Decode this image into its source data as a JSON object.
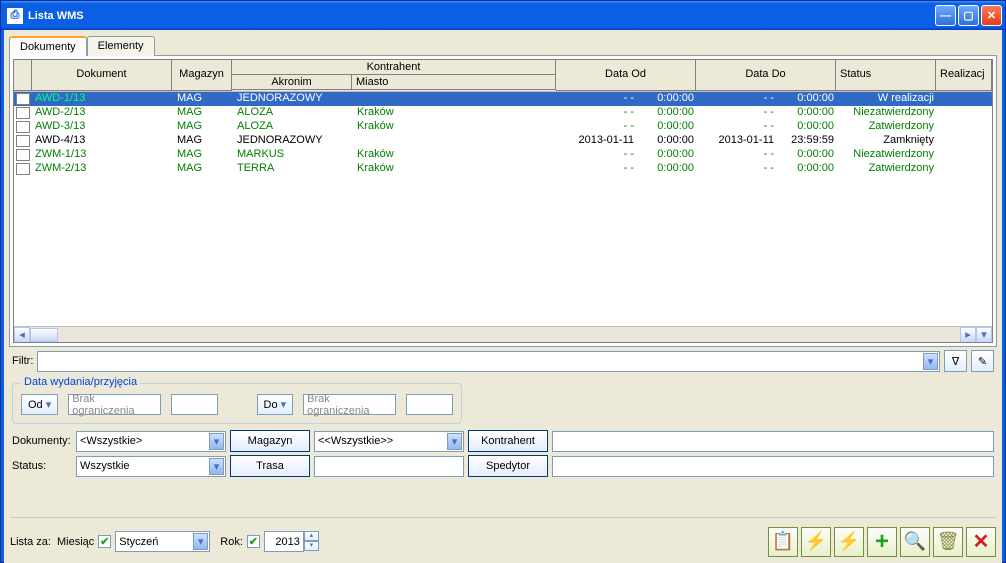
{
  "window": {
    "title": "Lista WMS"
  },
  "tabs": [
    {
      "label": "Dokumenty",
      "active": true
    },
    {
      "label": "Elementy",
      "active": false
    }
  ],
  "grid": {
    "headers": {
      "dokument": "Dokument",
      "magazyn": "Magazyn",
      "kontrahent": "Kontrahent",
      "akronim": "Akronim",
      "miasto": "Miasto",
      "dataod": "Data Od",
      "datado": "Data Do",
      "status": "Status",
      "realizacj": "Realizacj"
    },
    "rows": [
      {
        "sel": true,
        "green": true,
        "dokument": "AWD-1/13",
        "magazyn": "MAG",
        "akronim": "JEDNORAZOWY",
        "miasto": "",
        "od_d": "- -",
        "od_t": "0:00:00",
        "do_d": "- -",
        "do_t": "0:00:00",
        "status": "W realizacji"
      },
      {
        "sel": false,
        "green": true,
        "dokument": "AWD-2/13",
        "magazyn": "MAG",
        "akronim": "ALOZA",
        "miasto": "Kraków",
        "od_d": "- -",
        "od_t": "0:00:00",
        "do_d": "- -",
        "do_t": "0:00:00",
        "status": "Niezatwierdzony"
      },
      {
        "sel": false,
        "green": true,
        "dokument": "AWD-3/13",
        "magazyn": "MAG",
        "akronim": "ALOZA",
        "miasto": "Kraków",
        "od_d": "- -",
        "od_t": "0:00:00",
        "do_d": "- -",
        "do_t": "0:00:00",
        "status": "Zatwierdzony"
      },
      {
        "sel": false,
        "green": false,
        "dokument": "AWD-4/13",
        "magazyn": "MAG",
        "akronim": "JEDNORAZOWY",
        "miasto": "",
        "od_d": "2013-01-11",
        "od_t": "0:00:00",
        "do_d": "2013-01-11",
        "do_t": "23:59:59",
        "status": "Zamknięty"
      },
      {
        "sel": false,
        "green": true,
        "dokument": "ZWM-1/13",
        "magazyn": "MAG",
        "akronim": "MARKUS",
        "miasto": "Kraków",
        "od_d": "- -",
        "od_t": "0:00:00",
        "do_d": "- -",
        "do_t": "0:00:00",
        "status": "Niezatwierdzony"
      },
      {
        "sel": false,
        "green": true,
        "dokument": "ZWM-2/13",
        "magazyn": "MAG",
        "akronim": "TERRA",
        "miasto": "Kraków",
        "od_d": "- -",
        "od_t": "0:00:00",
        "do_d": "- -",
        "do_t": "0:00:00",
        "status": "Zatwierdzony"
      }
    ]
  },
  "filter": {
    "label": "Filtr:"
  },
  "dategroup": {
    "legend": "Data wydania/przyjęcia",
    "od": "Od",
    "do": "Do",
    "placeholder": "Brak ograniczenia"
  },
  "form": {
    "dokumenty_lbl": "Dokumenty:",
    "dokumenty_val": "<Wszystkie>",
    "magazyn_btn": "Magazyn",
    "magazyn_val": "<<Wszystkie>>",
    "kontrahent_btn": "Kontrahent",
    "status_lbl": "Status:",
    "status_val": "Wszystkie",
    "trasa_btn": "Trasa",
    "spedytor_btn": "Spedytor"
  },
  "bottom": {
    "listaza": "Lista za:",
    "miesiac_lbl": "Miesiąc",
    "miesiac_val": "Styczeń",
    "rok_lbl": "Rok:",
    "rok_val": "2013"
  }
}
